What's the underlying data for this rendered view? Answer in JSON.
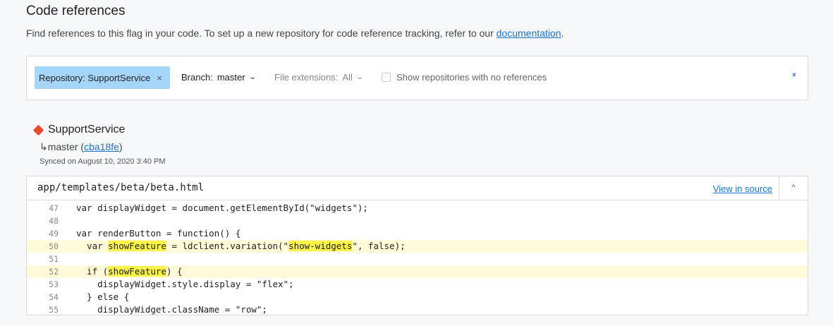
{
  "header": {
    "title": "Code references",
    "description": "Find references to this flag in your code. To set up a new repository for code reference tracking, refer to our ",
    "doc_link": "documentation",
    "description_end": "."
  },
  "filters": {
    "repository_chip": "Repository: SupportService",
    "chip_remove": "×",
    "branch_label": "Branch:",
    "branch_value": "master",
    "ext_label": "File extensions:",
    "ext_value": "All",
    "show_empty_label": "Show repositories with no references"
  },
  "repo": {
    "name": "SupportService",
    "branch_arrow": "↳",
    "branch": "master",
    "commit": "cba18fe",
    "synced": "Synced on August 10, 2020 3:40 PM"
  },
  "file": {
    "path": "app/templates/beta/beta.html",
    "view_in_source": "View in source",
    "lines": [
      {
        "num": "47",
        "parts": [
          {
            "t": "var displayWidget = document.getElementById(\"widgets\");"
          }
        ]
      },
      {
        "num": "48",
        "parts": [
          {
            "t": ""
          }
        ]
      },
      {
        "num": "49",
        "parts": [
          {
            "t": "var renderButton = function() {"
          }
        ]
      },
      {
        "num": "50",
        "hl": true,
        "parts": [
          {
            "t": "  var "
          },
          {
            "t": "showFeature",
            "m": true
          },
          {
            "t": " = ldclient.variation(\""
          },
          {
            "t": "show-widgets",
            "m": true
          },
          {
            "t": "\", false);"
          }
        ]
      },
      {
        "num": "51",
        "parts": [
          {
            "t": ""
          }
        ]
      },
      {
        "num": "52",
        "hl": true,
        "parts": [
          {
            "t": "  if ("
          },
          {
            "t": "showFeature",
            "m": true
          },
          {
            "t": ") {"
          }
        ]
      },
      {
        "num": "53",
        "parts": [
          {
            "t": "    displayWidget.style.display = \"flex\";"
          }
        ]
      },
      {
        "num": "54",
        "parts": [
          {
            "t": "  } else {"
          }
        ]
      },
      {
        "num": "55",
        "parts": [
          {
            "t": "    displayWidget.className = \"row\";"
          }
        ]
      }
    ]
  }
}
